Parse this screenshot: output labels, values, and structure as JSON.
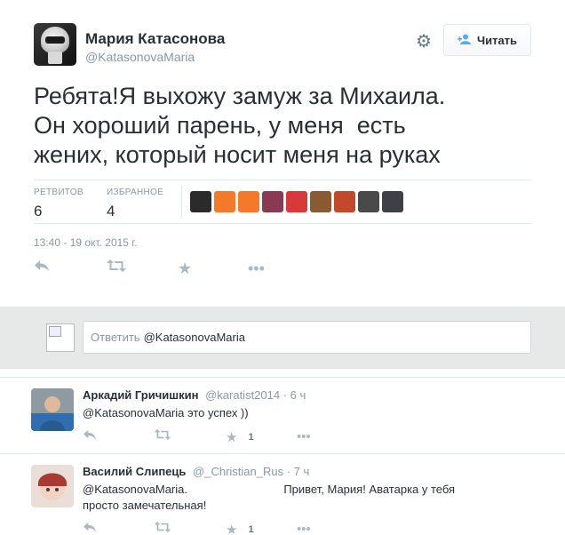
{
  "author": {
    "name": "Мария Катасонова",
    "handle": "@KatasonovaMaria"
  },
  "follow": {
    "label": "Читать",
    "icon": "add-user-icon"
  },
  "settings": {
    "icon": "gear-icon"
  },
  "tweet": {
    "text": "Ребята!Я выхожу замуж за Михаила.\nОн хороший парень, у меня  есть\nжених, который носит меня на руках",
    "retweets_label": "РЕТВИТОВ",
    "retweets": "6",
    "favorites_label": "ИЗБРАННОЕ",
    "favorites": "4",
    "timestamp": "13:40 - 19 окт. 2015 г.",
    "favoriter_colors": [
      "#2b2b2b",
      "#f47a2a",
      "#f47a2a",
      "#8a3b52",
      "#d83a3a",
      "#8a5a32",
      "#c24a2a",
      "#4a4a4a",
      "#3f3f46"
    ]
  },
  "tweet_actions": {
    "reply_icon": "reply-icon",
    "retweet_icon": "retweet-icon",
    "favorite_icon": "star-icon",
    "more_icon": "more-icon"
  },
  "reply_box": {
    "placeholder": "Ответить",
    "mention": "@KatasonovaMaria"
  },
  "replies": [
    {
      "name": "Аркадий Гричишкин",
      "handle": "@karatist2014",
      "time": "· 6 ч",
      "text": "@KatasonovaMaria это успех ))",
      "favorites": "1"
    },
    {
      "name": "Василий Слипець",
      "handle": "@_Christian_Rus",
      "time": "· 7 ч",
      "text": "@KatasonovaMaria.                              Привет, Мария! Аватарка у тебя\nпросто замечательная!",
      "favorites": "1"
    }
  ]
}
